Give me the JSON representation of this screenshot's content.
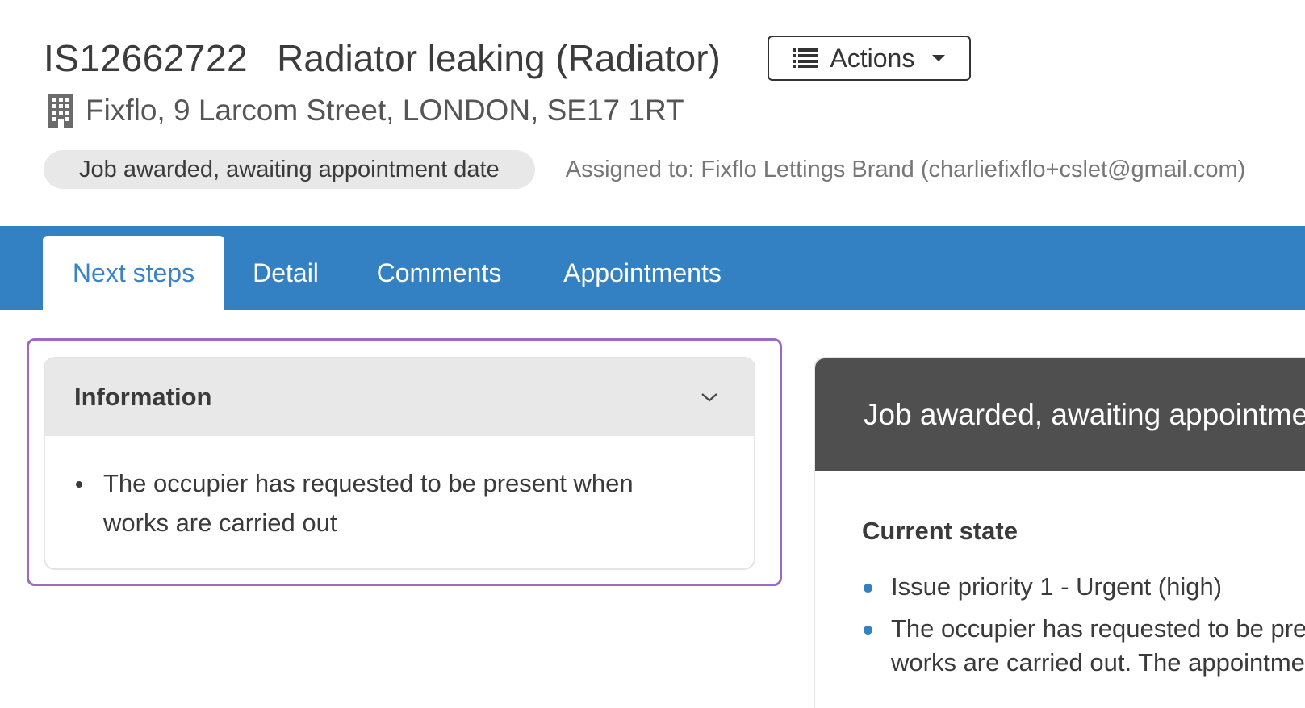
{
  "header": {
    "issue_ref": "IS12662722",
    "issue_title": "Radiator leaking (Radiator)",
    "actions_label": "Actions",
    "address": "Fixflo, 9 Larcom Street, LONDON, SE17 1RT",
    "status_pill": "Job awarded, awaiting appointment date",
    "assigned_to": "Assigned to: Fixflo Lettings Brand (charliefixflo+cslet@gmail.com)"
  },
  "tabs": [
    {
      "label": "Next steps",
      "active": true
    },
    {
      "label": "Detail",
      "active": false
    },
    {
      "label": "Comments",
      "active": false
    },
    {
      "label": "Appointments",
      "active": false
    }
  ],
  "information_panel": {
    "title": "Information",
    "items": [
      {
        "line1": "The occupier has requested to be present when",
        "line2": "works are carried out"
      }
    ]
  },
  "status_card": {
    "title": "Job awarded, awaiting appointment date",
    "current_state_heading": "Current state",
    "items": [
      {
        "line1": "Issue priority 1 - Urgent (high)"
      },
      {
        "line1": "The occupier has requested to be present when",
        "line2": "works are carried out. The appointment"
      }
    ]
  },
  "colors": {
    "tab_bar": "#3381c3",
    "active_tab_text": "#3b83c6",
    "highlight_border": "#9b6bc4",
    "status_card_header": "#4f4f4f",
    "bullet_blue": "#3381c3"
  },
  "icons": {
    "actions": "list-icon",
    "dropdown": "caret-down-icon",
    "address": "building-icon",
    "collapse": "chevron-down-icon"
  }
}
